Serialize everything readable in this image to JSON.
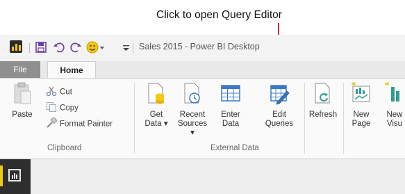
{
  "annotation": {
    "callout": "Click to open Query Editor"
  },
  "window": {
    "title": "Sales 2015 - Power BI Desktop"
  },
  "quick_access": {
    "icons": [
      "powerbi-app-icon",
      "save-icon",
      "undo-icon",
      "redo-icon",
      "smiley-icon",
      "customize-icon"
    ]
  },
  "tabs": {
    "file": "File",
    "home": "Home"
  },
  "clipboard": {
    "paste": "Paste",
    "cut": "Cut",
    "copy": "Copy",
    "format_painter": "Format Painter",
    "group_label": "Clipboard"
  },
  "external_data": {
    "get_data": [
      "Get",
      "Data ▾"
    ],
    "recent_sources": [
      "Recent",
      "Sources ▾"
    ],
    "enter_data": [
      "Enter",
      "Data"
    ],
    "edit_queries": [
      "Edit",
      "Queries"
    ],
    "group_label": "External Data"
  },
  "refresh": {
    "label": "Refresh"
  },
  "new_page": [
    "New",
    "Page"
  ],
  "new_visual": [
    "New",
    "Visu"
  ],
  "colors": {
    "accent": "#f2c811",
    "arrow": "#d3262b",
    "file_tab": "#8f8f8f",
    "sidebar": "#2e2e2e"
  }
}
